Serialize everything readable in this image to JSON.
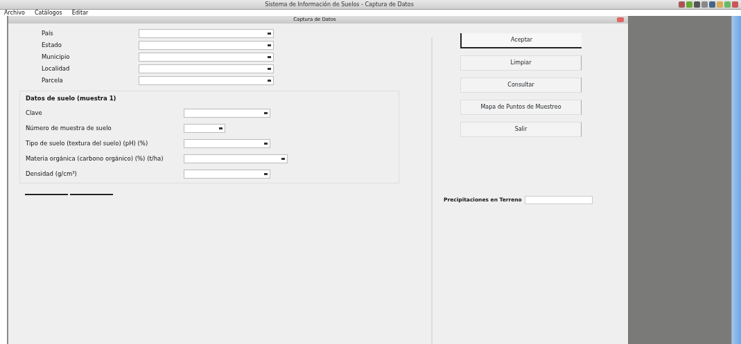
{
  "window": {
    "title": "Sistema de Información de Suelos - Captura de Datos"
  },
  "menu": [
    "Archivo",
    "Catálogos",
    "Editar"
  ],
  "inner_window": {
    "title": "Captura de Datos"
  },
  "location_fields": [
    {
      "label": "País"
    },
    {
      "label": "Estado"
    },
    {
      "label": "Municipio"
    },
    {
      "label": "Localidad"
    },
    {
      "label": "Parcela"
    }
  ],
  "sample_group": {
    "title": "Datos de suelo (muestra 1)",
    "fields": [
      {
        "label": "Clave"
      },
      {
        "label": "Número de muestra de suelo"
      },
      {
        "label": "Tipo de suelo (textura del suelo) (pH) (%)"
      },
      {
        "label": "Materia orgánica (carbono orgánico) (%) (t/ha)"
      },
      {
        "label": "Densidad (g/cm³)"
      }
    ]
  },
  "buttons": [
    {
      "label": "Aceptar",
      "selected": true
    },
    {
      "label": "Limpiar",
      "selected": false
    },
    {
      "label": "Consultar",
      "selected": false
    },
    {
      "label": "Mapa de Puntos de Muestreo",
      "selected": false
    },
    {
      "label": "Salir",
      "selected": false
    }
  ],
  "total": {
    "label": "Precipitaciones en Terreno"
  }
}
